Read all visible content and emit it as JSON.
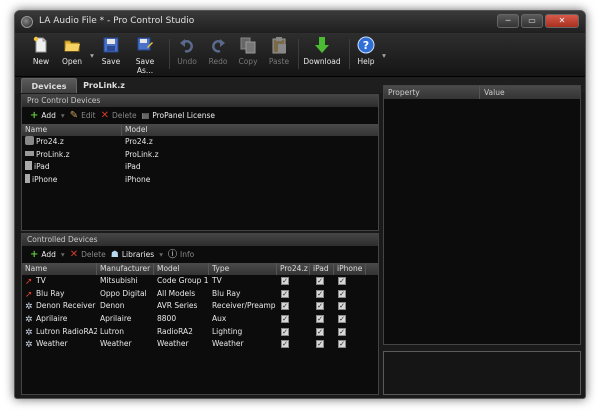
{
  "window": {
    "title": "LA Audio File * - Pro Control Studio"
  },
  "toolbar": {
    "new": "New",
    "open": "Open",
    "save": "Save",
    "save_as": "Save As...",
    "undo": "Undo",
    "redo": "Redo",
    "copy": "Copy",
    "paste": "Paste",
    "download": "Download",
    "help": "Help"
  },
  "tabs": [
    "Devices",
    "ProLink.z"
  ],
  "pro_control": {
    "title": "Pro Control Devices",
    "actions": {
      "add": "Add",
      "edit": "Edit",
      "delete": "Delete",
      "license": "ProPanel License"
    },
    "columns": [
      "Name",
      "Model"
    ],
    "rows": [
      {
        "name": "Pro24.z",
        "model": "Pro24.z",
        "icon": "remote-icon"
      },
      {
        "name": "ProLink.z",
        "model": "ProLink.z",
        "icon": "prolink-icon"
      },
      {
        "name": "iPad",
        "model": "iPad",
        "icon": "tablet-icon"
      },
      {
        "name": "iPhone",
        "model": "iPhone",
        "icon": "phone-icon"
      }
    ]
  },
  "controlled": {
    "title": "Controlled Devices",
    "actions": {
      "add": "Add",
      "delete": "Delete",
      "libraries": "Libraries",
      "info": "Info"
    },
    "columns": [
      "Name",
      "Manufacturer",
      "Model",
      "Type",
      "Pro24.z",
      "iPad",
      "iPhone"
    ],
    "rows": [
      {
        "name": "TV",
        "manufacturer": "Mitsubishi",
        "model": "Code Group 1",
        "type": "TV",
        "icon": "ir-icon",
        "pro24": true,
        "ipad": true,
        "iphone": true
      },
      {
        "name": "Blu Ray",
        "manufacturer": "Oppo Digital",
        "model": "All Models",
        "type": "Blu Ray",
        "icon": "ir-icon",
        "pro24": true,
        "ipad": true,
        "iphone": true
      },
      {
        "name": "Denon Receiver",
        "manufacturer": "Denon",
        "model": "AVR Series",
        "type": "Receiver/Preamp",
        "icon": "gear-icon",
        "pro24": true,
        "ipad": true,
        "iphone": true
      },
      {
        "name": "Aprilaire",
        "manufacturer": "Aprilaire",
        "model": "8800",
        "type": "Aux",
        "icon": "gear-icon",
        "pro24": true,
        "ipad": true,
        "iphone": true
      },
      {
        "name": "Lutron RadioRA2",
        "manufacturer": "Lutron",
        "model": "RadioRA2",
        "type": "Lighting",
        "icon": "gear-icon",
        "pro24": true,
        "ipad": true,
        "iphone": true
      },
      {
        "name": "Weather",
        "manufacturer": "Weather",
        "model": "Weather",
        "type": "Weather",
        "icon": "gear-icon",
        "pro24": true,
        "ipad": true,
        "iphone": true
      }
    ]
  },
  "properties": {
    "columns": [
      "Property",
      "Value"
    ]
  },
  "colors": {
    "background": "#0c0c0c",
    "header": "#3a3a3a",
    "add_green": "#5fc43b",
    "delete_red": "#d23a2a",
    "help_blue": "#2f6fd6",
    "download_green": "#4cbb34"
  }
}
